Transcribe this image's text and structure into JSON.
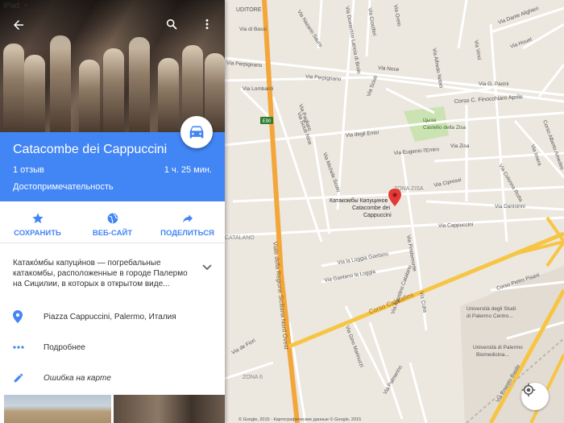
{
  "status_bar": {
    "device": "iPad"
  },
  "place": {
    "title": "Catacombe dei Cappuccini",
    "reviews": "1 отзыв",
    "travel_time": "1 ч. 25 мин.",
    "category": "Достопримечательность",
    "description": "Катако́мбы капуци́нов — погребальные катакомбы, расположенные в городе Палермо на Сицилии, в которых в открытом виде..."
  },
  "actions": [
    {
      "label": "СОХРАНИТЬ",
      "icon": "star-icon"
    },
    {
      "label": "ВЕБ-САЙТ",
      "icon": "globe-icon"
    },
    {
      "label": "ПОДЕЛИТЬСЯ",
      "icon": "share-icon"
    }
  ],
  "details": [
    {
      "text": "Piazza Cappuccini, Palermo, Италия",
      "icon": "location-pin-icon"
    },
    {
      "text": "Подробнее",
      "icon": "more-dots-icon"
    },
    {
      "text": "Ошибка на карте",
      "icon": "pencil-icon"
    }
  ],
  "colors": {
    "accent": "#4285f4",
    "map_bg": "#ece7df",
    "main_road": "#f3a73b",
    "park": "#cbe3b3",
    "pin": "#e53935"
  },
  "map": {
    "streets": [
      "UDITORE",
      "Via Nazario Sauro",
      "Via Domenico Lancia di Brolo",
      "Via Oreto",
      "Via Crociferi",
      "Via Dante Alighieri",
      "Via Houel",
      "Via Vinci",
      "Via Alfredo Nobel",
      "Via Noce",
      "Via G. Pacini",
      "Corso C. Finocchiaro Aprile",
      "Via Perpignano",
      "Via Lombardi",
      "Via Sciuti",
      "Via Pagliaro",
      "Via Aquileia",
      "Via Cappuccini",
      "Via degli Emiri",
      "Via Eugenio l'Emiro",
      "Via Zisa",
      "ZONA ZISA",
      "Via Cipressi",
      "Via Danisinni",
      "Via Colonna Rotta",
      "Via Imera",
      "Via Scirocco",
      "Corso Alberto Amedeo",
      "Via Michele Scoto",
      "Via Sciuti Nina",
      "CATALANO",
      "Via Pindemonte",
      "Via la Loggia Gaetano",
      "Via Gaetano la Loggia",
      "Corso Calatafimi",
      "Corso Pietro Pisani",
      "Viale della Regione Siciliana Nord Ovest",
      "Via Gino Marinuzzi",
      "Via Agostino Catalano",
      "Via Cuba",
      "Via Palmerino",
      "Via Ernesto Basile",
      "ZONA 6",
      "Via de Fiori",
      "Via di Bassi"
    ],
    "route_shield": "E90",
    "park_label": "Цыза\nCastello della Zisa",
    "university1": "Università degli Studi\ndi Palermo Centro...",
    "university2": "Università di Palermo\nBiomedicina...",
    "poi_label": "Катакомбы Капуцинов\nCatacombe dei\nCappuccini",
    "copyright": "© Google, 2015 · Картографические данные © Google, 2015"
  }
}
